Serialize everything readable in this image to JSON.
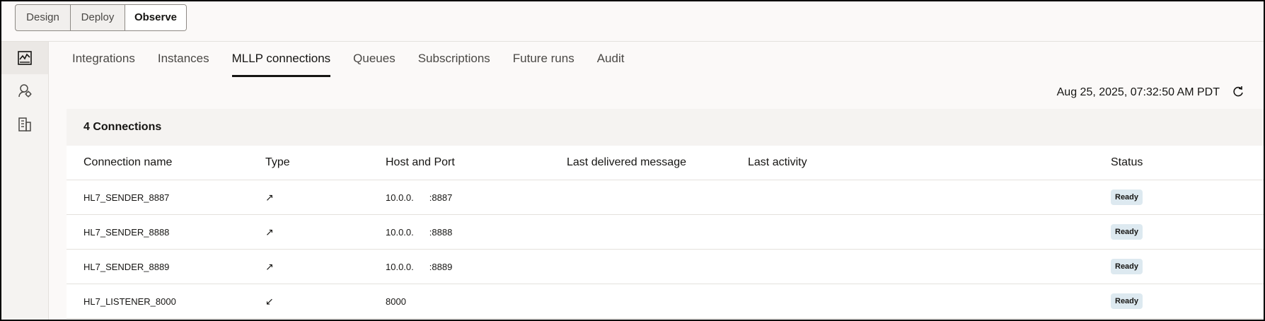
{
  "modes": [
    {
      "label": "Design"
    },
    {
      "label": "Deploy"
    },
    {
      "label": "Observe",
      "active": true
    }
  ],
  "rail": [
    {
      "icon": "monitoring-icon",
      "active": true
    },
    {
      "icon": "agent-icon"
    },
    {
      "icon": "building-icon"
    }
  ],
  "tabs": [
    {
      "label": "Integrations"
    },
    {
      "label": "Instances"
    },
    {
      "label": "MLLP connections",
      "active": true
    },
    {
      "label": "Queues"
    },
    {
      "label": "Subscriptions"
    },
    {
      "label": "Future runs"
    },
    {
      "label": "Audit"
    }
  ],
  "timestamp": "Aug 25, 2025, 07:32:50 AM PDT",
  "refresh_icon": "refresh-icon",
  "panel": {
    "title": "4 Connections",
    "columns": [
      "Connection name",
      "Type",
      "Host and Port",
      "Last delivered message",
      "Last activity",
      "Status"
    ],
    "rows": [
      {
        "name": "HL7_SENDER_8887",
        "type_arrow": "↗",
        "host": "10.0.0.",
        "port": ":8887",
        "last_message": "",
        "last_activity": "",
        "status": "Ready"
      },
      {
        "name": "HL7_SENDER_8888",
        "type_arrow": "↗",
        "host": "10.0.0.",
        "port": ":8888",
        "last_message": "",
        "last_activity": "",
        "status": "Ready"
      },
      {
        "name": "HL7_SENDER_8889",
        "type_arrow": "↗",
        "host": "10.0.0.",
        "port": ":8889",
        "last_message": "",
        "last_activity": "",
        "status": "Ready"
      },
      {
        "name": "HL7_LISTENER_8000",
        "type_arrow": "↙",
        "host": "8000",
        "port": "",
        "last_message": "",
        "last_activity": "",
        "status": "Ready"
      }
    ]
  },
  "colors": {
    "accent": "#161513",
    "badge_bg": "#dde9f0",
    "background": "#fbf9f8"
  }
}
